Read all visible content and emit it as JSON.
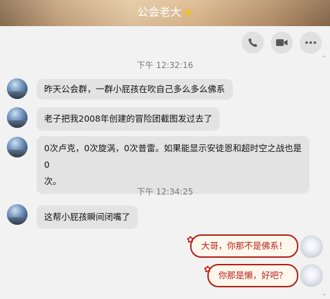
{
  "header": {
    "title": "公会老大"
  },
  "toolbar": {
    "icons": [
      "phone-icon",
      "video-icon",
      "more-icon"
    ]
  },
  "messages": {
    "time1": "下午 12:32:16",
    "m1": "昨天公会群，一群小屁孩在吹自己多么多么佛系",
    "m2": "老子把我2008年创建的冒险团截图发过去了",
    "m3_line1": "0次卢克，0次旋涡，0次普雷。如果能显示安徒恩和超时空之战也是0",
    "m3_line2": "次。",
    "time2": "下午 12:34:25",
    "m4": "这帮小屁孩瞬间闭嘴了",
    "m5": "大哥，你那不是佛系！",
    "m6": "你那是懒，好吧？"
  },
  "colors": {
    "header_accent": "#c8a57e",
    "my_bubble_border": "#b01e14",
    "my_bubble_text": "#b5231a",
    "their_bubble": "#e3e3e3"
  }
}
